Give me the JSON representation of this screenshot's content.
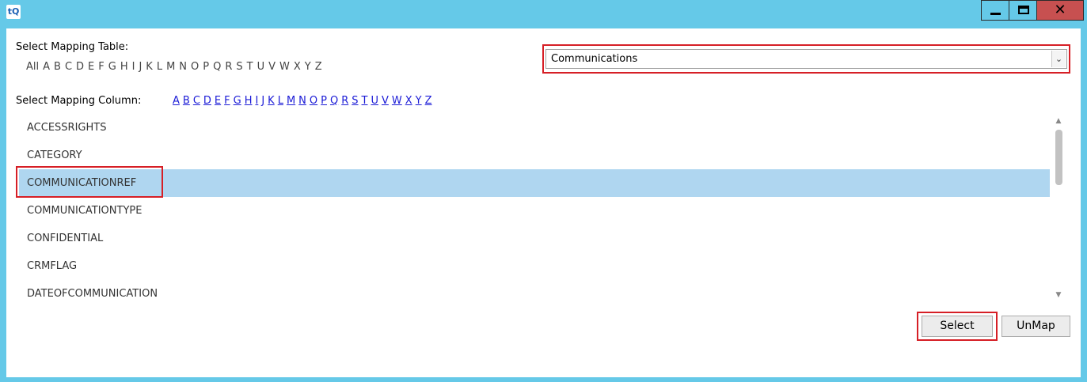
{
  "window": {
    "app_icon": "tQ",
    "close_glyph": "✕"
  },
  "mapping_table": {
    "label": "Select Mapping Table:",
    "filter_letters": [
      "All",
      "A",
      "B",
      "C",
      "D",
      "E",
      "F",
      "G",
      "H",
      "I",
      "J",
      "K",
      "L",
      "M",
      "N",
      "O",
      "P",
      "Q",
      "R",
      "S",
      "T",
      "U",
      "V",
      "W",
      "X",
      "Y",
      "Z"
    ],
    "selected_table": "Communications",
    "dropdown_arrow": "⌄"
  },
  "mapping_column": {
    "label": "Select Mapping Column:",
    "filter_letters": [
      "A",
      "B",
      "C",
      "D",
      "E",
      "F",
      "G",
      "H",
      "I",
      "J",
      "K",
      "L",
      "M",
      "N",
      "O",
      "P",
      "Q",
      "R",
      "S",
      "T",
      "U",
      "V",
      "W",
      "X",
      "Y",
      "Z"
    ],
    "items": [
      "ACCESSRIGHTS",
      "CATEGORY",
      "COMMUNICATIONREF",
      "COMMUNICATIONTYPE",
      "CONFIDENTIAL",
      "CRMFLAG",
      "DATEOFCOMMUNICATION"
    ],
    "selected_index": 2
  },
  "buttons": {
    "select_label": "Select",
    "unmap_label": "UnMap"
  },
  "colors": {
    "titlebar": "#65c9e8",
    "close_button": "#c75050",
    "selection": "#afd6f0",
    "highlight_outline": "#d61f26",
    "link": "#1a1ad6"
  }
}
